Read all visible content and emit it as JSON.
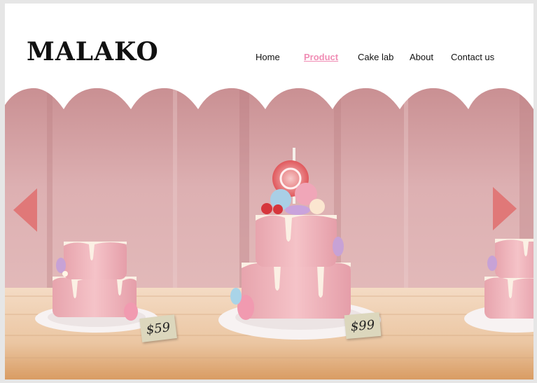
{
  "brand": {
    "logo_text": "MALAKO"
  },
  "nav": {
    "items": [
      {
        "label": "Home",
        "active": false
      },
      {
        "label": "Product",
        "active": true
      },
      {
        "label": "Cake lab",
        "active": false
      },
      {
        "label": "About",
        "active": false
      },
      {
        "label": "Contact us",
        "active": false
      }
    ]
  },
  "carousel": {
    "prev_icon": "triangle-left-icon",
    "next_icon": "triangle-right-icon",
    "arrow_color": "#e07878",
    "products": [
      {
        "price": "$59"
      },
      {
        "price": "$99"
      }
    ]
  },
  "colors": {
    "accent": "#f08cb4",
    "wall": "#d9a9aa",
    "table": "#ecc7a4"
  }
}
